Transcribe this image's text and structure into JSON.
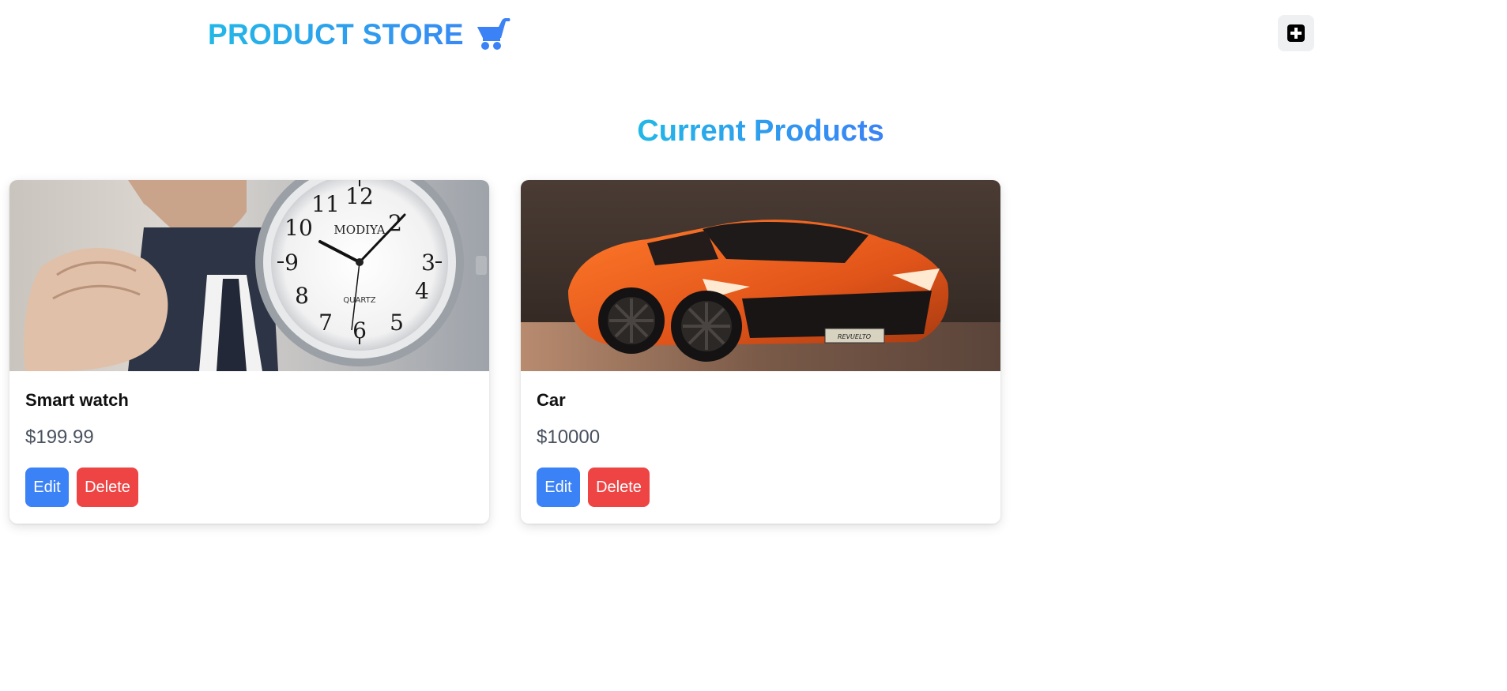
{
  "navbar": {
    "brand_text": "PRODUCT STORE",
    "cart_icon": "shopping-cart-icon",
    "add_icon": "plus-square-icon"
  },
  "page": {
    "heading": "Current Products"
  },
  "products": [
    {
      "name": "Smart watch",
      "price": "$199.99",
      "image": "wristwatch-photo",
      "watch_brand": "MODIYA",
      "watch_sub": "QUARTZ",
      "edit_label": "Edit",
      "delete_label": "Delete"
    },
    {
      "name": "Car",
      "price": "$10000",
      "image": "orange-sports-car-photo",
      "plate_text": "REVUELTO",
      "edit_label": "Edit",
      "delete_label": "Delete"
    }
  ],
  "colors": {
    "brand_gradient_start": "#22b8e6",
    "brand_gradient_end": "#3b82f6",
    "edit_button": "#3b82f6",
    "delete_button": "#ef4444"
  }
}
